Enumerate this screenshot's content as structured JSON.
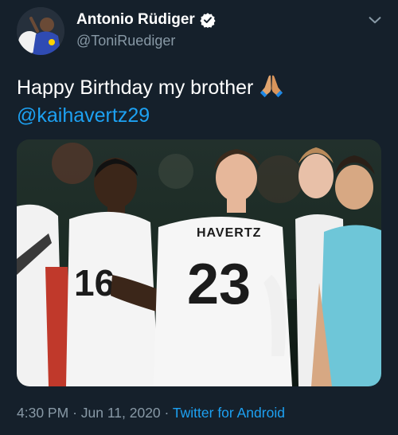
{
  "author": {
    "display_name": "Antonio Rüdiger",
    "handle": "@ToniRuediger",
    "verified": true
  },
  "tweet": {
    "text": "Happy Birthday my brother",
    "emoji": "folded-hands",
    "mention": "@kaihavertz29"
  },
  "media": {
    "jersey_name": "HAVERTZ",
    "jersey_number": "23"
  },
  "meta": {
    "time": "4:30 PM",
    "date": "Jun 11, 2020",
    "separator": "·",
    "source": "Twitter for Android"
  },
  "colors": {
    "background": "#15202b",
    "text": "#ffffff",
    "secondary": "#8899a6",
    "accent": "#1da1f2"
  },
  "icons": [
    "verified-badge-icon",
    "chevron-down-icon",
    "folded-hands-emoji"
  ]
}
